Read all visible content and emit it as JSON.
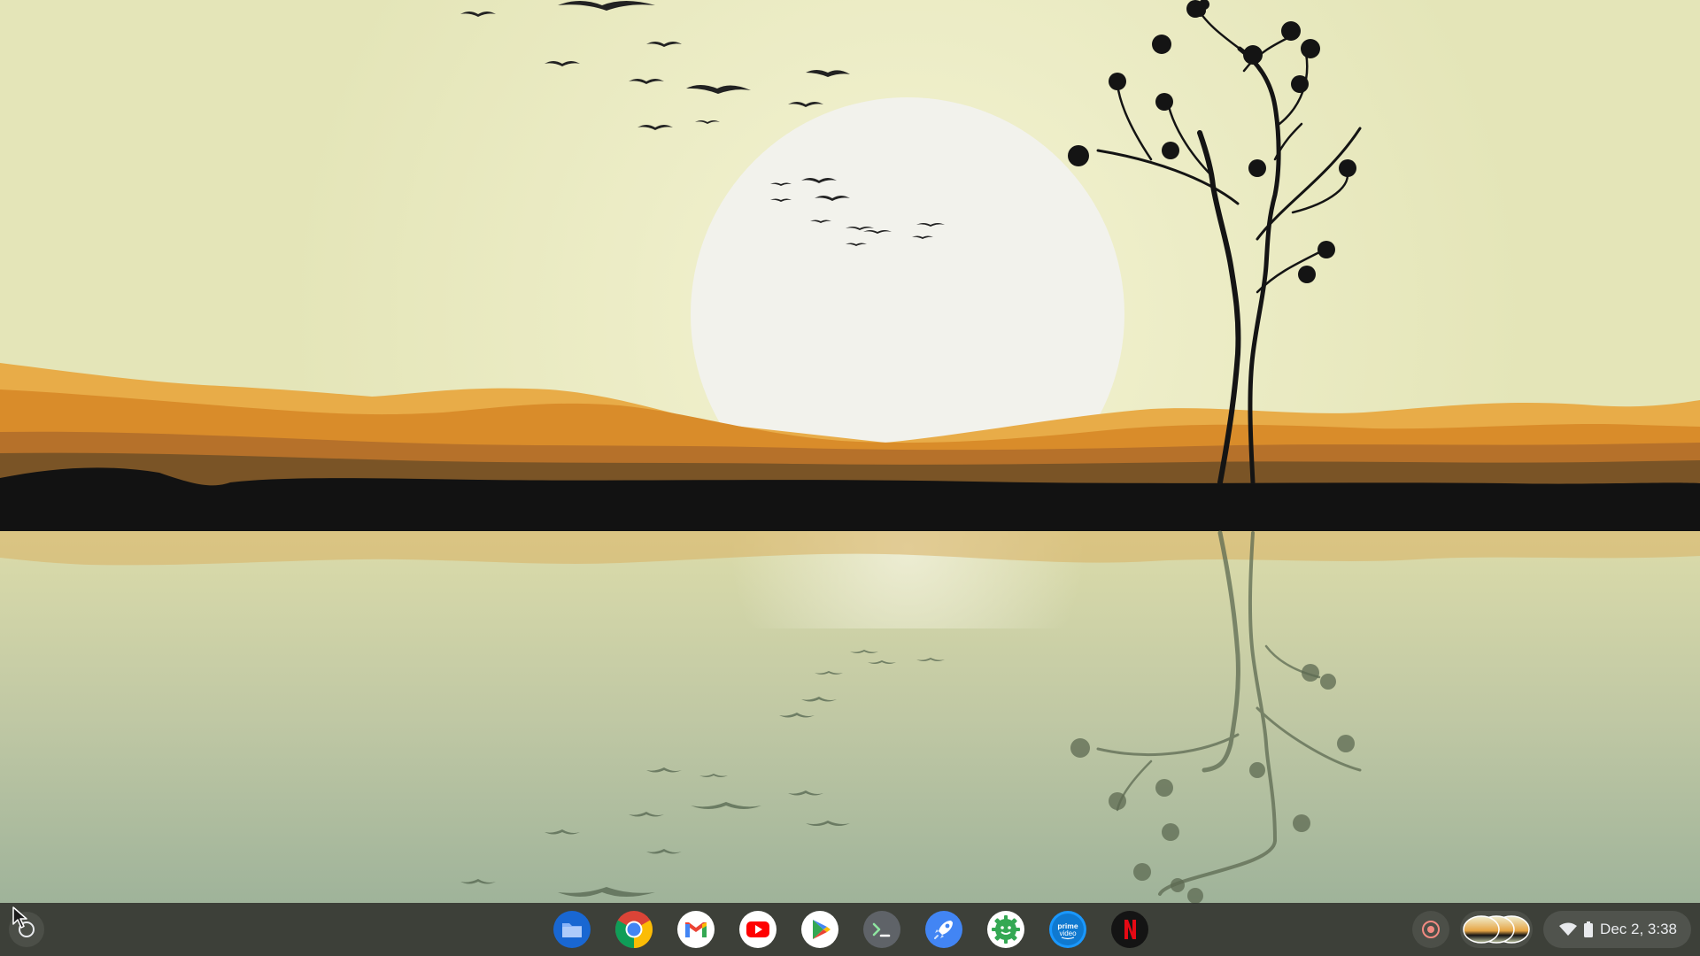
{
  "wallpaper": {
    "sky_color": "#e6e7bd",
    "sun_color": "#f2f2ec",
    "hill_colors": [
      "#e8a33a",
      "#d68a28",
      "#b86b1f",
      "#8a5a26"
    ],
    "shore_color": "#121212",
    "water_top_color": "#d7d9a8",
    "water_bottom_color": "#9fb39a"
  },
  "shelf": {
    "launcher_icon": "launcher-circle-icon",
    "cursor_icon": "mouse-pointer-icon",
    "apps": [
      {
        "id": "files",
        "icon": "folder-icon",
        "color": "#4285f4"
      },
      {
        "id": "chrome",
        "icon": "chrome-icon",
        "color": "#db4437"
      },
      {
        "id": "gmail",
        "icon": "gmail-icon",
        "color": "#ea4335"
      },
      {
        "id": "youtube",
        "icon": "youtube-icon",
        "color": "#ff0000"
      },
      {
        "id": "play-store",
        "icon": "play-store-icon",
        "color": "#34a853"
      },
      {
        "id": "terminal",
        "icon": "terminal-icon",
        "color": "#5f6368"
      },
      {
        "id": "explore",
        "icon": "rocket-icon",
        "color": "#4285f4"
      },
      {
        "id": "android-app",
        "icon": "android-gear-icon",
        "color": "#34a853"
      },
      {
        "id": "prime-video",
        "icon": "prime-video-icon",
        "color": "#1a98ff",
        "text": "prime video"
      },
      {
        "id": "netflix",
        "icon": "netflix-icon",
        "color": "#e50914",
        "text": "N"
      }
    ],
    "tray": {
      "screen_record_icon": "screen-record-icon",
      "holding_space_icon": "holding-space-thumbnails-icon",
      "wifi_icon": "wifi-icon",
      "battery_icon": "battery-icon",
      "datetime": "Dec 2, 3:38"
    }
  }
}
